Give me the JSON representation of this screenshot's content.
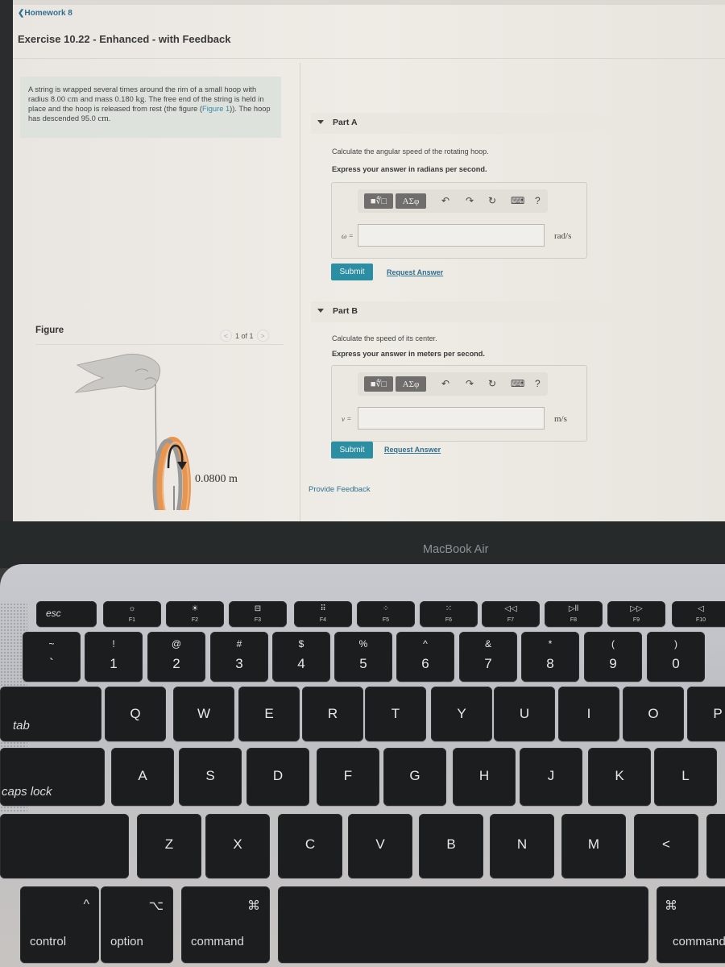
{
  "page": {
    "back_link": "❮Homework 8",
    "exercise_title": "Exercise 10.22 - Enhanced - with Feedback"
  },
  "problem": {
    "text_1": "A string is wrapped several times around the rim of a small hoop with radius 8.00 ",
    "unit_cm": "cm",
    "text_2": " and mass 0.180 ",
    "unit_kg": "kg",
    "text_3": ". The free end of the string is held in place and the hoop is released from rest (the figure (",
    "figure_link": "Figure 1",
    "text_4": ")). The hoop has descended 95.0 ",
    "text_5": "."
  },
  "figure": {
    "title": "Figure",
    "pager_prev": "<",
    "pager_text": "1 of 1",
    "pager_next": ">",
    "dimension_label": "0.0800 m",
    "hoop_color": "#e8954f"
  },
  "parts": [
    {
      "label": "Part A",
      "question": "Calculate the angular speed of the rotating hoop.",
      "instruction": "Express your answer in radians per second.",
      "variable": "ω =",
      "value": "",
      "unit": "rad/s",
      "submit": "Submit",
      "request": "Request Answer"
    },
    {
      "label": "Part B",
      "question": "Calculate the speed of its center.",
      "instruction": "Express your answer in meters per second.",
      "variable": "v =",
      "value": "",
      "unit": "m/s",
      "submit": "Submit",
      "request": "Request Answer"
    }
  ],
  "toolbar": {
    "templates": "■∜□",
    "greek": "ΑΣφ",
    "undo": "↶",
    "redo": "↷",
    "reset": "↻",
    "keyboard": "⌨",
    "help": "?"
  },
  "feedback_link": "Provide Feedback",
  "colors": {
    "accent": "#2b8ea3",
    "link": "#2f6f8f",
    "problem_bg": "#dde3dc"
  },
  "laptop": {
    "brand": "MacBook Air",
    "fn_row": [
      {
        "label": "esc"
      },
      {
        "glyph": "☼",
        "fn": "F1"
      },
      {
        "glyph": "☀",
        "fn": "F2"
      },
      {
        "glyph": "⊟",
        "fn": "F3"
      },
      {
        "glyph": "⠿",
        "fn": "F4"
      },
      {
        "glyph": "⁘",
        "fn": "F5"
      },
      {
        "glyph": "⁙",
        "fn": "F6"
      },
      {
        "glyph": "◁◁",
        "fn": "F7"
      },
      {
        "glyph": "▷ll",
        "fn": "F8"
      },
      {
        "glyph": "▷▷",
        "fn": "F9"
      },
      {
        "glyph": "◁",
        "fn": "F10"
      }
    ],
    "num_row": [
      {
        "top": "~",
        "main": "`"
      },
      {
        "top": "!",
        "main": "1"
      },
      {
        "top": "@",
        "main": "2"
      },
      {
        "top": "#",
        "main": "3"
      },
      {
        "top": "$",
        "main": "4"
      },
      {
        "top": "%",
        "main": "5"
      },
      {
        "top": "^",
        "main": "6"
      },
      {
        "top": "&",
        "main": "7"
      },
      {
        "top": "*",
        "main": "8"
      },
      {
        "top": "(",
        "main": "9"
      },
      {
        "top": ")",
        "main": "0"
      }
    ],
    "qwerty_row": [
      "tab",
      "Q",
      "W",
      "E",
      "R",
      "T",
      "Y",
      "U",
      "I",
      "O",
      "P"
    ],
    "asdf_row": [
      "caps lock",
      "A",
      "S",
      "D",
      "F",
      "G",
      "H",
      "J",
      "K",
      "L"
    ],
    "zxcv_row": [
      "Z",
      "X",
      "C",
      "V",
      "B",
      "N",
      "M",
      "<"
    ],
    "mod_row": [
      {
        "sym": "^",
        "label": "control"
      },
      {
        "sym": "⌥",
        "label": "option"
      },
      {
        "sym": "⌘",
        "label": "command"
      },
      {
        "sym": "",
        "label": ""
      },
      {
        "sym": "⌘",
        "label": "command"
      }
    ]
  }
}
